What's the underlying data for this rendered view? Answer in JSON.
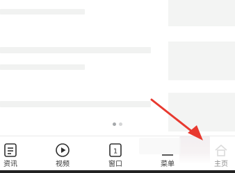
{
  "pager": {
    "pages": 2,
    "active_index": 0
  },
  "tabbar": {
    "items": [
      {
        "key": "news",
        "label": "资讯",
        "icon": "news-icon"
      },
      {
        "key": "video",
        "label": "视频",
        "icon": "play-icon"
      },
      {
        "key": "window",
        "label": "窗口",
        "icon": "window-count-icon",
        "count": "1"
      },
      {
        "key": "menu",
        "label": "菜单",
        "icon": "menu-icon"
      },
      {
        "key": "home",
        "label": "主页",
        "icon": "home-icon"
      }
    ]
  },
  "annotation": {
    "arrow_color": "#e8392f"
  }
}
